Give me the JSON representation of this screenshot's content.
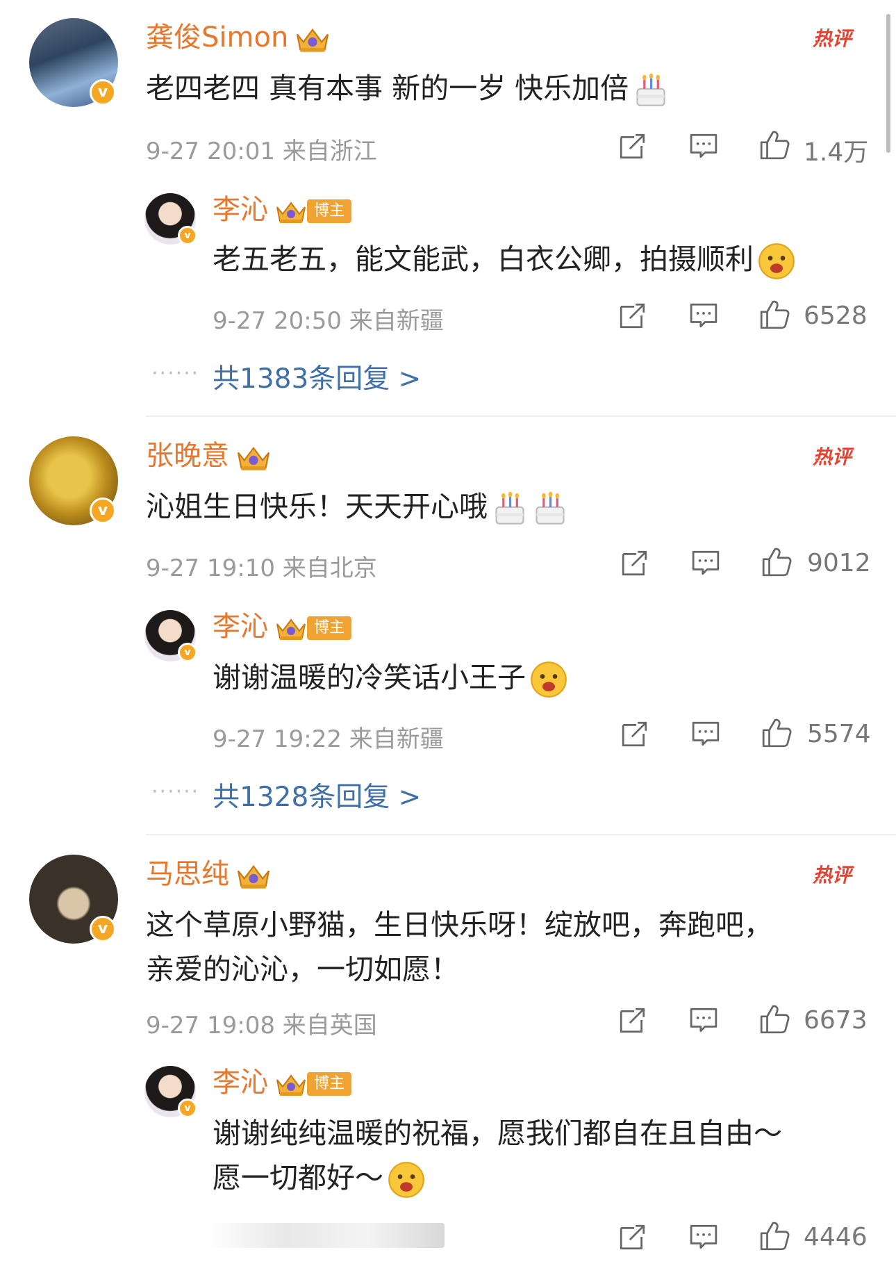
{
  "comments": [
    {
      "name": "龚俊Simon",
      "hot": "热评",
      "text": "老四老四 真有本事 新的一岁 快乐加倍",
      "meta": "9-27 20:01 来自浙江",
      "likes": "1.4万",
      "reply": {
        "name": "李沁",
        "tag": "博主",
        "text": "老五老五，能文能武，白衣公卿，拍摄顺利",
        "meta": "9-27 20:50 来自新疆",
        "likes": "6528"
      },
      "more": "共1383条回复 >"
    },
    {
      "name": "张晚意",
      "hot": "热评",
      "text": "沁姐生日快乐！天天开心哦",
      "meta": "9-27 19:10 来自北京",
      "likes": "9012",
      "reply": {
        "name": "李沁",
        "tag": "博主",
        "text": "谢谢温暖的冷笑话小王子",
        "meta": "9-27 19:22 来自新疆",
        "likes": "5574"
      },
      "more": "共1328条回复 >"
    },
    {
      "name": "马思纯",
      "hot": "热评",
      "text_line1": "这个草原小野猫，生日快乐呀！绽放吧，奔跑吧，",
      "text_line2": "亲爱的沁沁，一切如愿！",
      "meta": "9-27 19:08 来自英国",
      "likes": "6673",
      "reply": {
        "name": "李沁",
        "tag": "博主",
        "text_line1": "谢谢纯纯温暖的祝福，愿我们都自在且自由～",
        "text_line2": "愿一切都好～",
        "likes": "4446"
      }
    }
  ],
  "icons": [
    "share-icon",
    "comment-icon",
    "like-icon",
    "crown-icon",
    "cake-emoji",
    "verified-icon"
  ],
  "colors": {
    "name": "#e8772b",
    "link": "#3f6fa8",
    "hot": "#e8412f",
    "meta": "#9a9a9a",
    "badge": "#f5a623"
  }
}
